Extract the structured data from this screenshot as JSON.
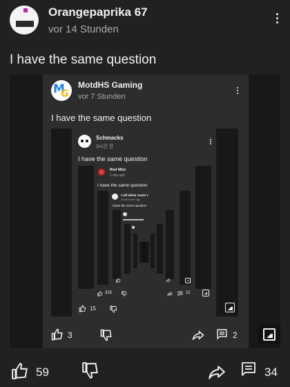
{
  "outer": {
    "author": "Orangepaprika 67",
    "time": "vor 14 Stunden",
    "text": "I have the same question",
    "likes": "59",
    "replies": "34"
  },
  "level1": {
    "author": "MotdHS Gaming",
    "time": "vor 7 Stunden",
    "text": "I have the same question",
    "likes": "3",
    "replies": "2",
    "avatar_letters": "MG"
  },
  "level2": {
    "author": "Schmacks",
    "time": "3시간 전",
    "text": "I have the same question",
    "likes": "15"
  },
  "level3": {
    "author": "Red Mist",
    "time": "1 day ago",
    "text": "I have the same question",
    "likes": "315",
    "replies": "22"
  },
  "level4": {
    "author": "I will defeat Justin Y",
    "time": "23 seconds ago",
    "text": "I have the same question"
  },
  "colors": {
    "background": "#212121",
    "text": "#f1f1f1",
    "muted": "#aaaaaa",
    "mg_blue": "#1e88e5",
    "mg_yellow": "#f6b800"
  },
  "icons": [
    "like-icon",
    "dislike-icon",
    "share-icon",
    "comment-icon",
    "image-icon",
    "more-vert-icon"
  ]
}
